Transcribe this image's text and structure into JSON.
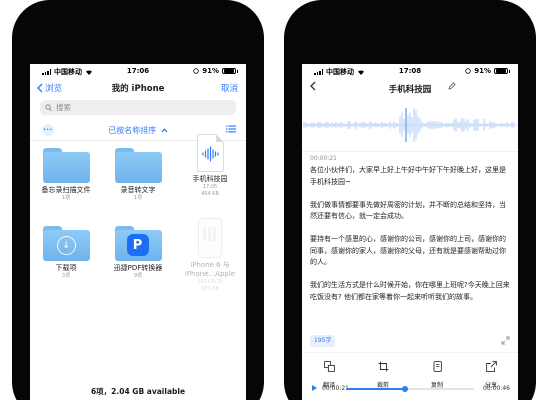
{
  "status_left": {
    "carrier": "中国移动",
    "time": "17:06",
    "battery": "91%"
  },
  "status_right": {
    "carrier": "中国移动",
    "time": "17:08",
    "battery": "91%"
  },
  "files": {
    "back_label": "浏览",
    "title": "我的 iPhone",
    "cancel_label": "取消",
    "search_placeholder": "搜索",
    "sort_label": "已按名称排序",
    "items": [
      {
        "name": "备忘录扫描文件",
        "sub": "1项",
        "kind": "folder"
      },
      {
        "name": "录音转文字",
        "sub": "1项",
        "kind": "folder"
      },
      {
        "name": "手机科技园",
        "sub": "17:05",
        "sub2": "454 KB",
        "kind": "audio-file"
      },
      {
        "name": "下载项",
        "sub": "3项",
        "kind": "download-folder"
      },
      {
        "name": "迅捷PDF转换器",
        "sub": "9项",
        "kind": "app-folder"
      },
      {
        "name": "iPhone 6 与 iPhone...Apple",
        "sub": "2021/6/15",
        "sub2": "181 KB",
        "kind": "faded-file"
      }
    ],
    "storage": "6项，2.04 GB available"
  },
  "recorder": {
    "title": "手机科技园",
    "wave_time": "00:00:21",
    "paragraphs": [
      "各位小伙伴们，大家早上好上午好中午好下午好晚上好，这里是手机科技园~",
      "我们做事情都要事先做好周密的计划，并不断的总结和坚持，当然还要有信心，就一定会成功。",
      "要持有一个感恩的心，感谢你的公司，感谢你的上司，感谢你的同事，感谢你的家人，感谢你的父母，还有就是要感谢帮助过你的人。",
      "我们的生活方式是什么时候开始，你在哪里上班呢?今天晚上回来吃饭没有? 他们都在家等着你一起来听听我们的故事。"
    ],
    "word_count": "195字",
    "actions": [
      {
        "label": "翻译",
        "icon": "translate-icon"
      },
      {
        "label": "裁剪",
        "icon": "crop-icon"
      },
      {
        "label": "复制",
        "icon": "copy-icon"
      },
      {
        "label": "分享",
        "icon": "share-icon"
      }
    ],
    "player": {
      "current": "00:00:21",
      "total": "00:00:46",
      "progress": 0.46
    }
  },
  "colors": {
    "accent": "#2f7cf6",
    "folder": "#7bbcef",
    "bezel": "#060606"
  }
}
